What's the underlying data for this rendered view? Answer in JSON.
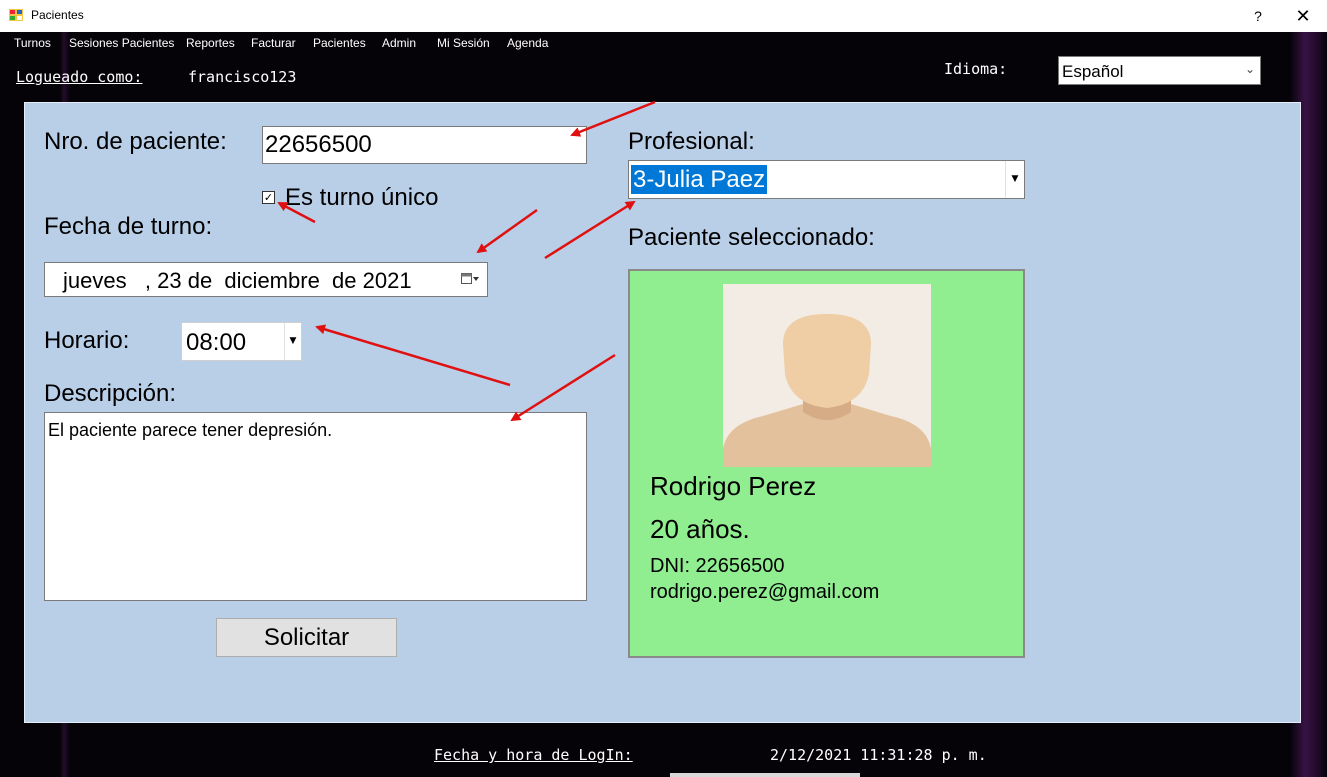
{
  "window": {
    "title": "Pacientes",
    "help_glyph": "?",
    "close_glyph": "✕"
  },
  "menu": [
    {
      "label": "Turnos"
    },
    {
      "label": "Sesiones Pacientes"
    },
    {
      "label": "Reportes"
    },
    {
      "label": "Facturar"
    },
    {
      "label": "Pacientes"
    },
    {
      "label": "Admin"
    },
    {
      "label": "Mi Sesión"
    },
    {
      "label": "Agenda"
    }
  ],
  "header": {
    "logged_label": "Logueado como:",
    "username": "francisco123",
    "language_label": "Idioma:",
    "language_value": "Español"
  },
  "form": {
    "patient_number_label": "Nro. de paciente:",
    "patient_number_value": "22656500",
    "single_turn_label": "Es turno único",
    "single_turn_checked": true,
    "date_label": "Fecha de turno:",
    "date_value": "jueves   , 23 de  diciembre  de 2021",
    "time_label": "Horario:",
    "time_value": "08:00",
    "description_label": "Descripción:",
    "description_value": "El paciente parece tener depresión.",
    "submit_label": "Solicitar",
    "professional_label": "Profesional:",
    "professional_value": "3-Julia Paez",
    "selected_patient_label": "Paciente seleccionado:"
  },
  "patient_card": {
    "name": "Rodrigo Perez",
    "age": "20 años.",
    "dni": "DNI: 22656500",
    "email": "rodrigo.perez@gmail.com",
    "background": "#90ee90"
  },
  "footer": {
    "login_time_label": "Fecha y hora de LogIn:",
    "login_time_value": "2/12/2021 11:31:28 p. m."
  },
  "colors": {
    "panel": "#b9cfe8",
    "selection": "#0078d7",
    "annotation_arrow": "#e01010"
  }
}
